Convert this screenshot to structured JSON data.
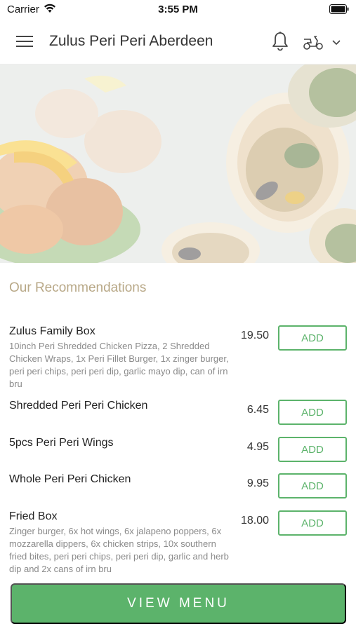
{
  "status_bar": {
    "carrier": "Carrier",
    "time": "3:55 PM"
  },
  "header": {
    "title": "Zulus Peri Peri Aberdeen",
    "icons": [
      "menu-icon",
      "bell-icon",
      "scooter-icon",
      "chevron-down-icon"
    ]
  },
  "recommendations": {
    "title": "Our Recommendations",
    "add_label": "ADD",
    "items": [
      {
        "name": "Zulus Family Box",
        "description": "10inch Peri Shredded Chicken Pizza, 2 Shredded Chicken Wraps, 1x Peri Fillet Burger, 1x zinger burger, peri peri chips, peri peri dip, garlic mayo dip, can of irn bru",
        "price": "19.50"
      },
      {
        "name": "Shredded Peri Peri Chicken",
        "description": "",
        "price": "6.45"
      },
      {
        "name": "5pcs Peri Peri Wings",
        "description": "",
        "price": "4.95"
      },
      {
        "name": "Whole Peri Peri Chicken",
        "description": "",
        "price": "9.95"
      },
      {
        "name": "Fried Box",
        "description": "Zinger burger, 6x hot wings, 6x jalapeno poppers, 6x mozzarella dippers, 6x chicken strips, 10x southern fried bites, peri peri chips, peri peri dip, garlic and herb dip and 2x cans of irn bru",
        "price": "18.00"
      }
    ]
  },
  "footer": {
    "view_menu_label": "VIEW MENU"
  },
  "colors": {
    "accent_green": "#5cb36b",
    "section_title": "#b8a887"
  }
}
